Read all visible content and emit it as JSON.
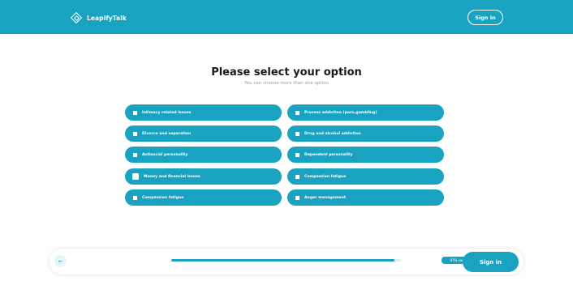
{
  "header": {
    "brand": "LeapifyTalk",
    "sign_in": "Sign In",
    "logo_icon": "leapifytalk-diamond-logo-icon",
    "bg_color": "#1aa3c0"
  },
  "main": {
    "title": "Please select your option",
    "subtitle": "You can choose more than one option"
  },
  "options": [
    {
      "label": "Intimacy related issues",
      "checked": false
    },
    {
      "label": "Process addiction (porn,gambling)",
      "checked": false
    },
    {
      "label": "Divorce and separation",
      "checked": false
    },
    {
      "label": "Drug and alcohol addiction",
      "checked": false
    },
    {
      "label": "Antisocial personality",
      "checked": false
    },
    {
      "label": "Dependent personality",
      "checked": false
    },
    {
      "label": "Money and financial issues",
      "checked": false
    },
    {
      "label": "Compassion fatigue",
      "checked": false
    },
    {
      "label": "Compassion fatigue",
      "checked": false
    },
    {
      "label": "Anger management",
      "checked": false
    }
  ],
  "footer": {
    "back_icon": "arrow-left-icon",
    "back_glyph": "←",
    "progress_text": "97% completed. Great going!",
    "progress_percent": 97,
    "sign_in": "Sign in"
  },
  "colors": {
    "accent": "#1aa3c0",
    "text_dark": "#1a1a1a",
    "text_muted": "#9a9a9a"
  }
}
